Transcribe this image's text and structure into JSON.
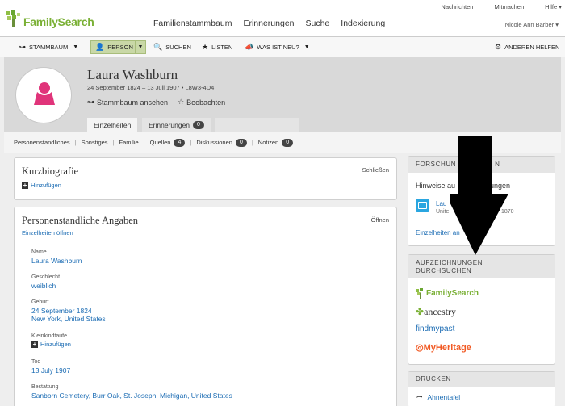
{
  "header": {
    "logo_text": "FamilySearch",
    "util_links": [
      "Nachrichten",
      "Mitmachen",
      "Hilfe ▾"
    ],
    "main_nav": [
      "Familienstammbaum",
      "Erinnerungen",
      "Suche",
      "Indexierung"
    ],
    "user_name": "Nicole Ann Barber ▾"
  },
  "toolbar": {
    "stammbaum": "STAMMBAUM",
    "person": "PERSON",
    "suchen": "SUCHEN",
    "listen": "LISTEN",
    "neu": "WAS IST NEU?",
    "helfen": "ANDEREN HELFEN"
  },
  "person": {
    "name": "Laura Washburn",
    "dates": "24 September 1824 – 13 Juli 1907 • L8W3-4D4",
    "view_tree": "Stammbaum ansehen",
    "watch": "Beobachten",
    "tabs": {
      "details": "Einzelheiten",
      "memories": "Erinnerungen",
      "memories_count": "0"
    }
  },
  "subtabs": {
    "vital": "Personenstandliches",
    "other": "Sonstiges",
    "family": "Familie",
    "sources": "Quellen",
    "sources_count": "4",
    "discussions": "Diskussionen",
    "discussions_count": "0",
    "notes": "Notizen",
    "notes_count": "0"
  },
  "bio": {
    "title": "Kurzbiografie",
    "close": "Schließen",
    "add": "Hinzufügen"
  },
  "vitals": {
    "title": "Personenstandliche Angaben",
    "open": "Öffnen",
    "open_details": "Einzelheiten öffnen",
    "name_label": "Name",
    "name_value": "Laura Washburn",
    "sex_label": "Geschlecht",
    "sex_value": "weiblich",
    "birth_label": "Geburt",
    "birth_date": "24 September 1824",
    "birth_place": "New York, United States",
    "christening_label": "Kleinkindtaufe",
    "christening_add": "Hinzufügen",
    "death_label": "Tod",
    "death_date": "13 July 1907",
    "burial_label": "Bestattung",
    "burial_place": "Sanborn Cemetery, Burr Oak, St. Joseph, Michigan, United States"
  },
  "sidebar": {
    "research_head": "FORSCHUN",
    "research_head_tail": "N",
    "hints_text": "Hinweise au",
    "hints_text_tail": "nungen",
    "hint_name": "Lau",
    "hint_sub": "Unite",
    "hint_year": "1870",
    "hints_link": "Einzelheiten an",
    "search_head_1": "AUFZEICHNUNGEN",
    "search_head_2": "DURCHSUCHEN",
    "brands": [
      "FamilySearch",
      "ancestry",
      "findmypast",
      "MyHeritage"
    ],
    "print_head": "DRUCKEN",
    "print_item": "Ahnentafel"
  },
  "colors": {
    "brand_green": "#7ab035",
    "link_blue": "#1a6bb3",
    "avatar_pink": "#e0347a",
    "myheritage_orange": "#f15a24"
  }
}
